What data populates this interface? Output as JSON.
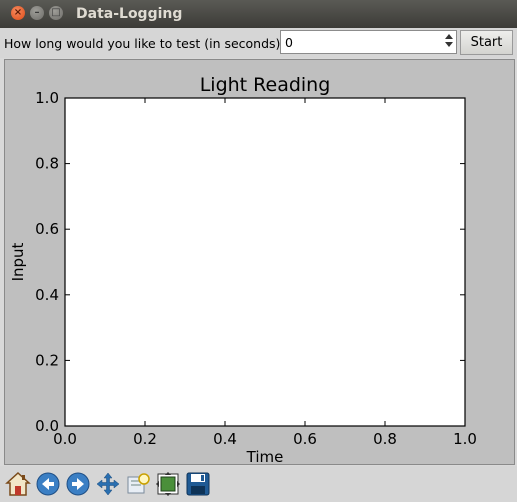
{
  "window": {
    "title": "Data-Logging"
  },
  "controls": {
    "prompt": "How long would you like to test (in seconds):",
    "duration_value": "0",
    "start_label": "Start"
  },
  "chart_data": {
    "type": "line",
    "title": "Light Reading",
    "xlabel": "Time",
    "ylabel": "Input",
    "xlim": [
      0.0,
      1.0
    ],
    "ylim": [
      0.0,
      1.0
    ],
    "x_ticks": [
      "0.0",
      "0.2",
      "0.4",
      "0.6",
      "0.8",
      "1.0"
    ],
    "y_ticks": [
      "0.0",
      "0.2",
      "0.4",
      "0.6",
      "0.8",
      "1.0"
    ],
    "series": [],
    "grid": false
  },
  "toolbar": {
    "icons": [
      "home-icon",
      "back-icon",
      "forward-icon",
      "pan-icon",
      "zoom-icon",
      "subplots-icon",
      "save-icon"
    ]
  },
  "colors": {
    "figure_bg": "#bfbfbf",
    "axes_bg": "#ffffff",
    "accent": "#1f77b4"
  }
}
